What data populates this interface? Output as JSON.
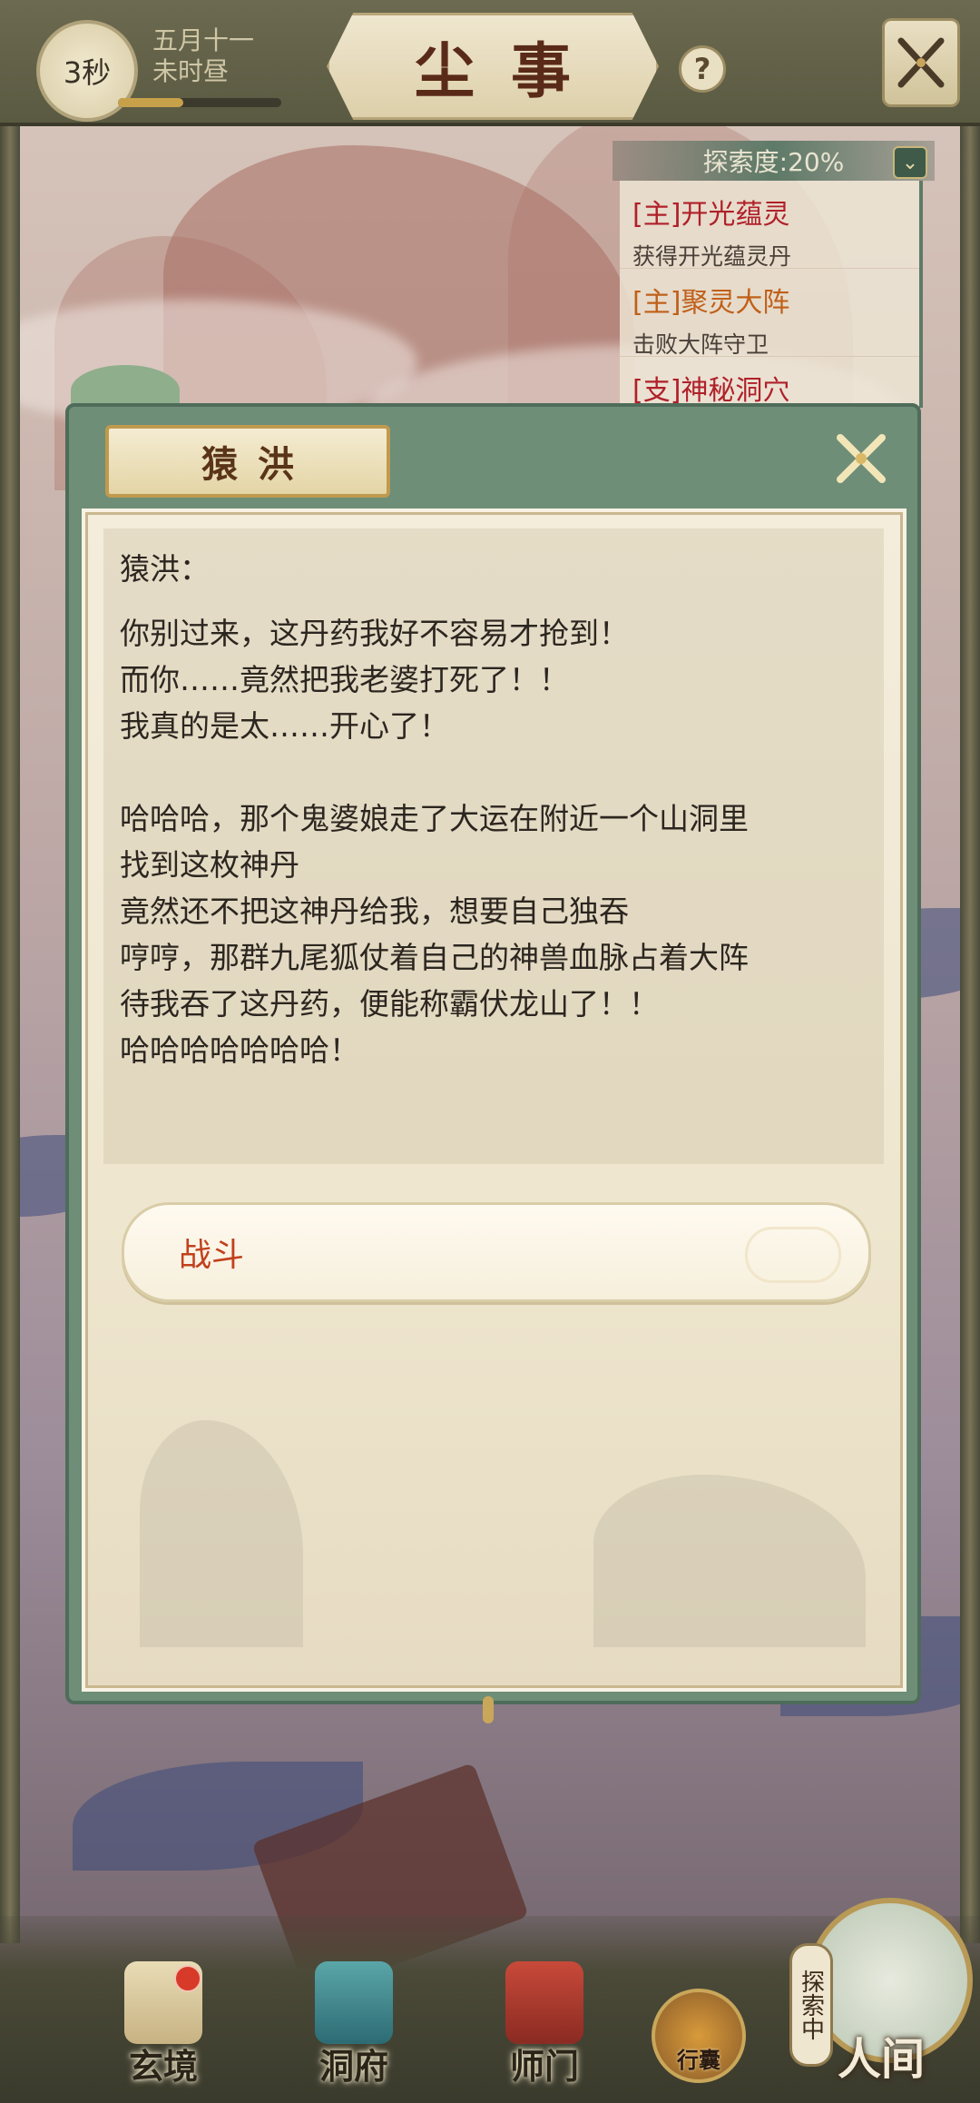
{
  "topbar": {
    "timer": "3秒",
    "date_line1": "五月十一",
    "date_line2": "未时昼",
    "title": "尘事",
    "help": "?"
  },
  "quests": {
    "progress": "探索度:20%",
    "items": [
      {
        "title": "[主]开光蕴灵",
        "desc": "获得开光蕴灵丹"
      },
      {
        "title": "[主]聚灵大阵",
        "desc": "击败大阵守卫"
      },
      {
        "title": "[支]神秘洞穴",
        "desc": ""
      }
    ]
  },
  "dialog": {
    "header": "猿洪",
    "speaker": "猿洪：",
    "lines": [
      "你别过来，这丹药我好不容易才抢到！",
      "而你……竟然把我老婆打死了！！",
      "我真的是太……开心了！",
      "",
      "哈哈哈，那个鬼婆娘走了大运在附近一个山洞里",
      "找到这枚神丹",
      "竟然还不把这神丹给我，想要自己独吞",
      "哼哼，那群九尾狐仗着自己的神兽血脉占着大阵",
      "待我吞了这丹药，便能称霸伏龙山了！！",
      "哈哈哈哈哈哈哈！"
    ],
    "choice": "战斗"
  },
  "nav": {
    "items": [
      "玄境",
      "洞府",
      "师门"
    ],
    "bag": "行囊",
    "world_tag": "探索中",
    "world": "人间"
  },
  "colors": {
    "accent_green": "#6e8e78",
    "choice_text": "#c2401c",
    "quest_main": "#b0202a"
  }
}
